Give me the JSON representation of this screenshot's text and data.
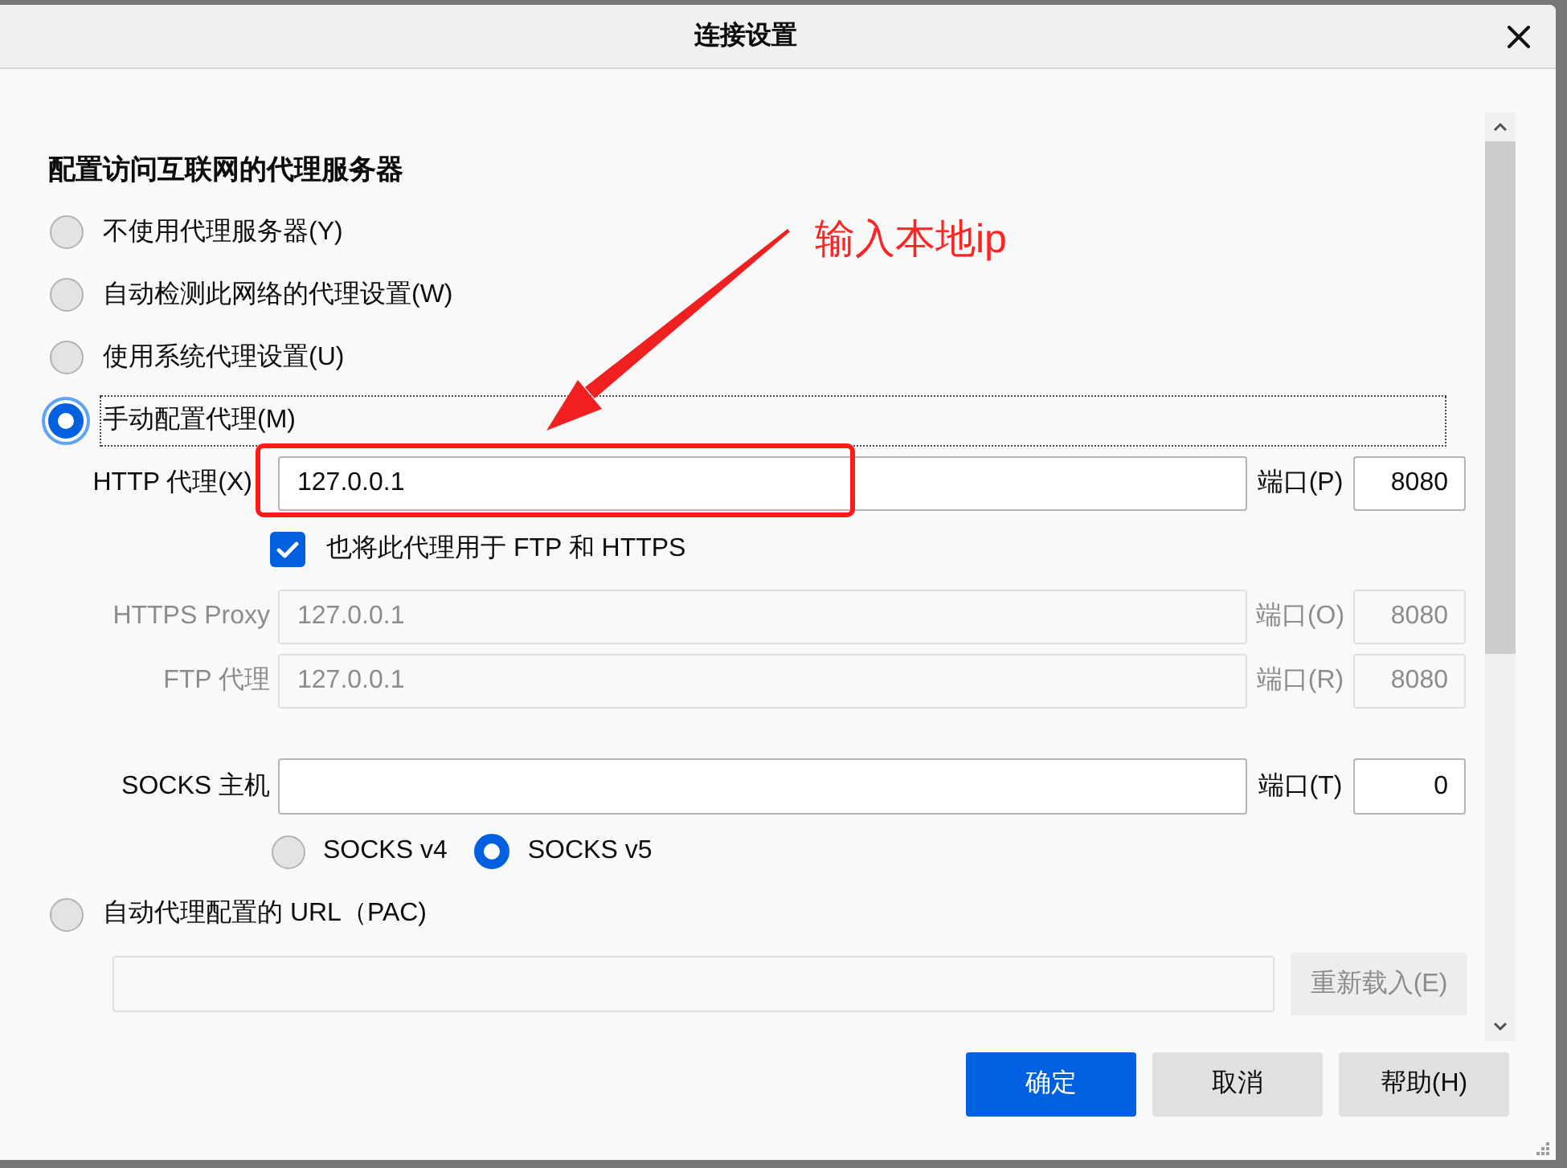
{
  "window": {
    "title": "连接设置"
  },
  "annotation": {
    "text": "输入本地ip"
  },
  "section_title": "配置访问互联网的代理服务器",
  "proxy_modes": [
    {
      "label": "不使用代理服务器(Y)",
      "selected": false,
      "focused": false
    },
    {
      "label": "自动检测此网络的代理设置(W)",
      "selected": false,
      "focused": false
    },
    {
      "label": "使用系统代理设置(U)",
      "selected": false,
      "focused": false
    },
    {
      "label": "手动配置代理(M)",
      "selected": true,
      "focused": true
    }
  ],
  "http_proxy": {
    "label": "HTTP 代理(X)",
    "value": "127.0.0.1",
    "port_label": "端口(P)",
    "port": "8080",
    "disabled": false
  },
  "share_proxy": {
    "label": "也将此代理用于 FTP 和 HTTPS",
    "checked": true
  },
  "other_proxies": [
    {
      "label": "HTTPS Proxy",
      "value": "127.0.0.1",
      "port_label": "端口(O)",
      "port": "8080",
      "disabled": true
    },
    {
      "label": "FTP 代理",
      "value": "127.0.0.1",
      "port_label": "端口(R)",
      "port": "8080",
      "disabled": true
    }
  ],
  "socks": {
    "label": "SOCKS 主机",
    "port_label": "端口(T)",
    "port": "0",
    "disabled": false
  },
  "socks_versions": [
    {
      "label": "SOCKS v4",
      "selected": false
    },
    {
      "label": "SOCKS v5",
      "selected": true
    }
  ],
  "pac": {
    "label": "自动代理配置的 URL（PAC)",
    "selected": false,
    "url_disabled": true,
    "reload_button": {
      "label": "重新载入(E)",
      "disabled": true
    }
  },
  "buttons": [
    {
      "label": "确定",
      "kind": "primary"
    },
    {
      "label": "取消",
      "kind": "secondary"
    },
    {
      "label": "帮助(H)",
      "kind": "secondary"
    }
  ]
}
